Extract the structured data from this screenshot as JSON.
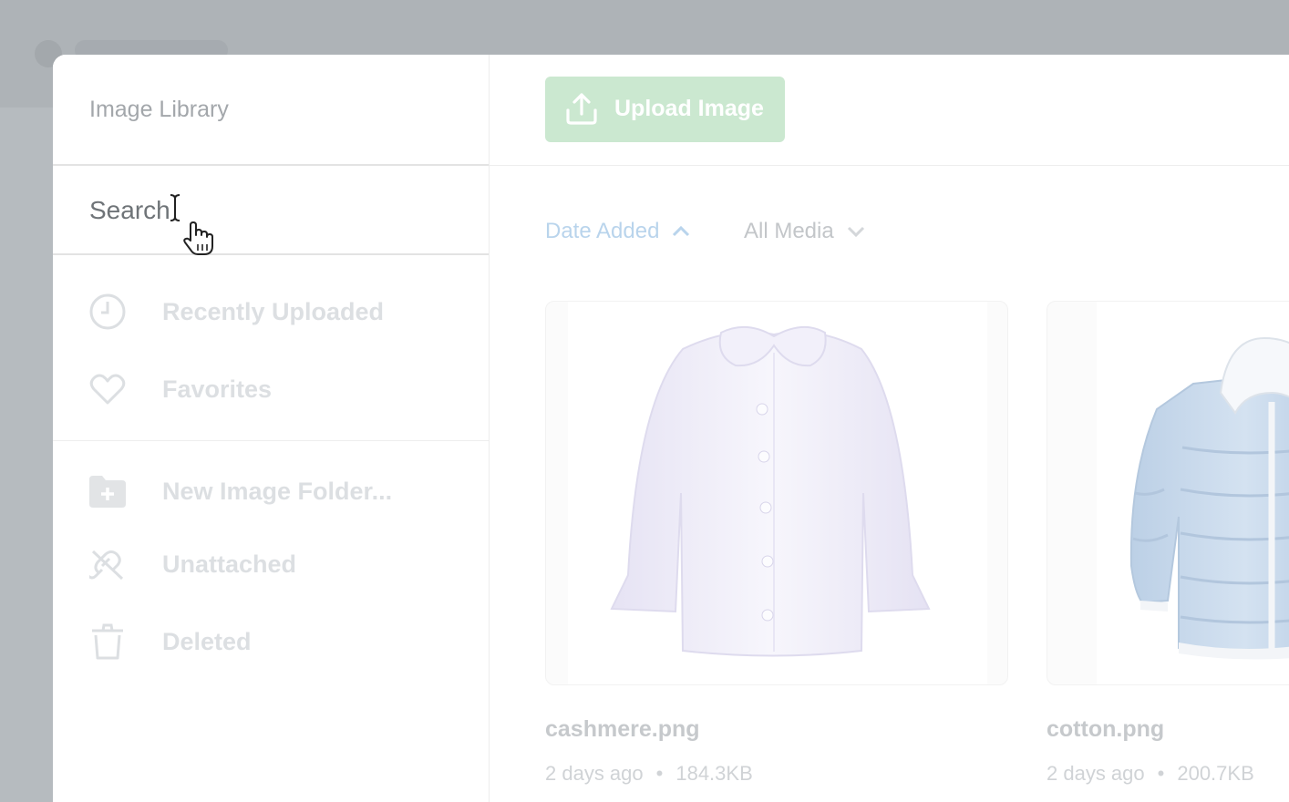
{
  "sidebar": {
    "title": "Image Library",
    "search": {
      "value": "Search"
    },
    "items": [
      {
        "label": "Recently Uploaded",
        "icon": "clock-icon"
      },
      {
        "label": "Favorites",
        "icon": "heart-icon"
      },
      {
        "label": "New Image Folder...",
        "icon": "folder-plus-icon"
      },
      {
        "label": "Unattached",
        "icon": "unlink-icon"
      },
      {
        "label": "Deleted",
        "icon": "trash-icon"
      }
    ]
  },
  "toolbar": {
    "upload_label": "Upload Image",
    "upload_icon": "upload-icon"
  },
  "filters": {
    "sort_label": "Date Added",
    "media_label": "All Media"
  },
  "images": [
    {
      "name": "cashmere.png",
      "age": "2 days ago",
      "size": "184.3KB"
    },
    {
      "name": "cotton.png",
      "age": "2 days ago",
      "size": "200.7KB"
    }
  ],
  "colors": {
    "accent_upload": "#cbe8d0",
    "accent_sort": "#b9d4ec",
    "backdrop": "#b6bbbf"
  }
}
